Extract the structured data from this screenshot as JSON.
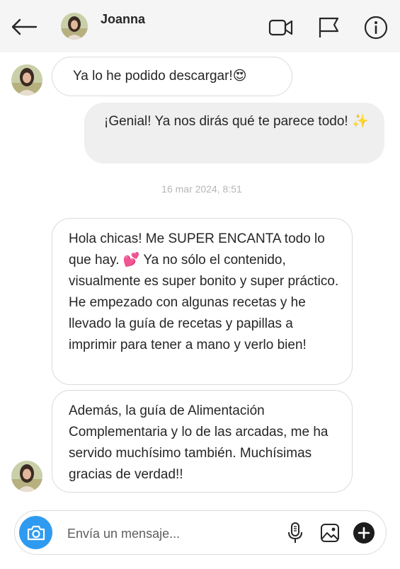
{
  "header": {
    "contact_name": "Joanna",
    "icons": [
      "back-arrow-icon",
      "video-call-icon",
      "flag-icon",
      "info-icon"
    ]
  },
  "messages": [
    {
      "direction": "incoming",
      "text": "Ya lo he podido descargar!😍"
    },
    {
      "direction": "outgoing",
      "text": "¡Genial! Ya nos dirás qué te parece todo! ✨"
    },
    {
      "direction": "incoming",
      "text": "Hola chicas! Me SUPER ENCANTA todo lo que hay. 💕 Ya no sólo el contenido, visualmente es super bonito y super práctico. He empezado con algunas recetas y he llevado la guía de recetas y papillas a imprimir para tener a mano y verlo bien!"
    },
    {
      "direction": "incoming",
      "text": "Además, la guía de Alimentación Complementaria y lo de las arcadas, me ha servido muchísimo también. Muchísimas gracias de verdad!!"
    }
  ],
  "timestamp": "16 mar 2024, 8:51",
  "composer": {
    "placeholder": "Envía un mensaje...",
    "icons": [
      "camera-icon",
      "microphone-icon",
      "image-icon",
      "plus-icon"
    ]
  },
  "colors": {
    "header_bg": "#f5f5f5",
    "outgoing_bubble": "#efefef",
    "incoming_border": "#dbdbdb",
    "camera_button": "#2e9bf0",
    "timestamp_text": "#b6b6b6"
  }
}
